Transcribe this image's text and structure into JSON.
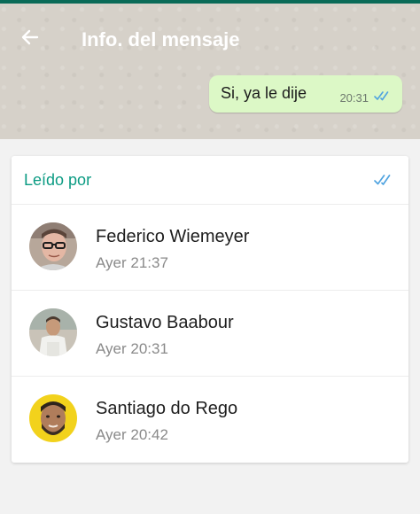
{
  "header": {
    "title": "Info. del mensaje",
    "back_icon": "arrow-left-icon"
  },
  "message": {
    "text": "Si, ya le dije",
    "time": "20:31",
    "status_icon": "double-check-icon",
    "bubble_color": "#dcf8c6",
    "tick_color": "#4fa3e0"
  },
  "read_by": {
    "label": "Leído por",
    "status_icon": "double-check-icon",
    "accent_color": "#0b9b83",
    "contacts": [
      {
        "name": "Federico Wiemeyer",
        "time": "Ayer 21:37",
        "avatar_icon": "contact-photo"
      },
      {
        "name": "Gustavo Baabour",
        "time": "Ayer 20:31",
        "avatar_icon": "contact-photo"
      },
      {
        "name": "Santiago do Rego",
        "time": "Ayer 20:42",
        "avatar_icon": "contact-photo"
      }
    ]
  }
}
